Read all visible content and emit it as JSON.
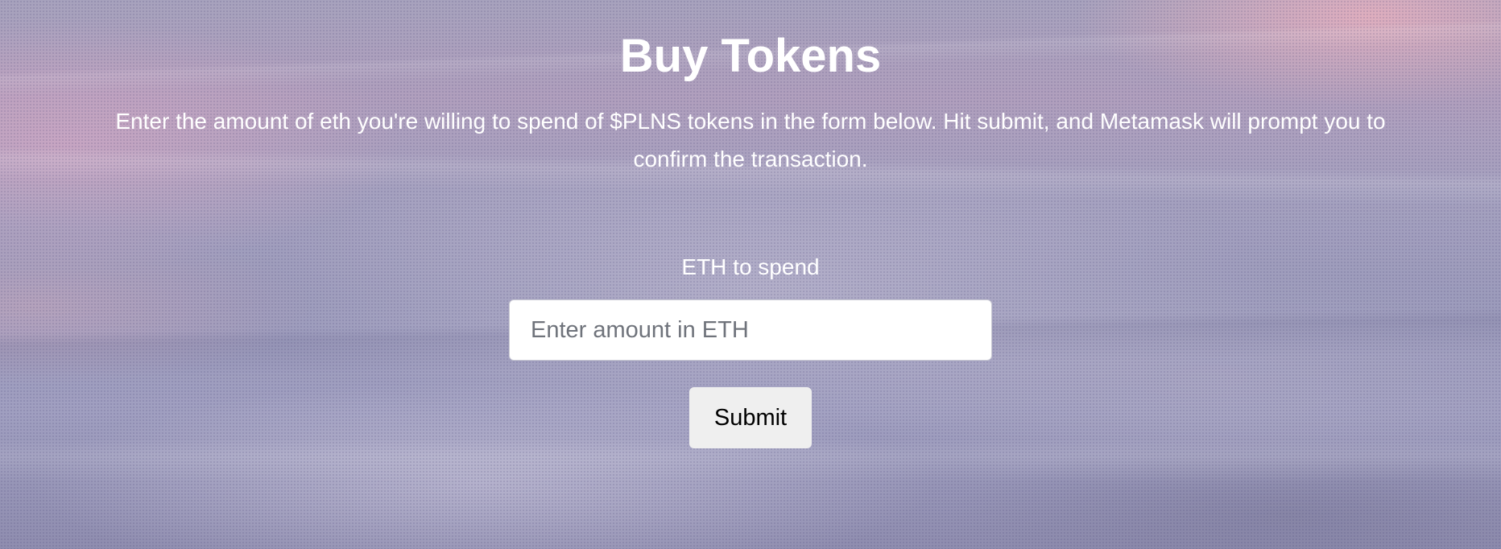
{
  "page": {
    "title": "Buy Tokens",
    "description": "Enter the amount of eth you're willing to spend of $PLNS tokens in the form below. Hit submit, and Metamask will prompt you to confirm the transaction."
  },
  "form": {
    "label": "ETH to spend",
    "input_placeholder": "Enter amount in ETH",
    "input_value": "",
    "submit_label": "Submit"
  }
}
